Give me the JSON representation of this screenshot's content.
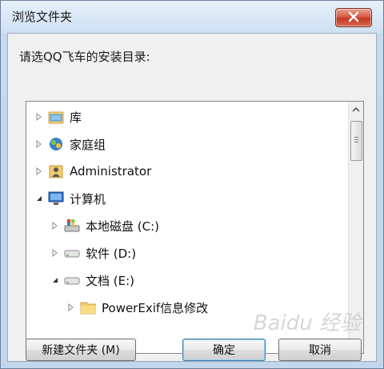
{
  "window": {
    "title": "浏览文件夹",
    "prompt": "请选QQ飞车的安装目录:"
  },
  "tree": {
    "items": [
      {
        "label": "库",
        "icon": "library-icon",
        "expander": "collapsed"
      },
      {
        "label": "家庭组",
        "icon": "homegroup-icon",
        "expander": "collapsed"
      },
      {
        "label": "Administrator",
        "icon": "user-folder-icon",
        "expander": "collapsed"
      },
      {
        "label": "计算机",
        "icon": "computer-icon",
        "expander": "expanded"
      },
      {
        "label": "本地磁盘 (C:)",
        "icon": "system-drive-icon",
        "expander": "collapsed"
      },
      {
        "label": "软件 (D:)",
        "icon": "drive-icon",
        "expander": "collapsed"
      },
      {
        "label": "文档 (E:)",
        "icon": "drive-icon",
        "expander": "expanded"
      },
      {
        "label": "PowerExif信息修改",
        "icon": "folder-icon",
        "expander": "collapsed"
      }
    ]
  },
  "buttons": {
    "new_folder": "新建文件夹 (M)",
    "ok": "确定",
    "cancel": "取消"
  },
  "watermark": "Baidu 经验"
}
